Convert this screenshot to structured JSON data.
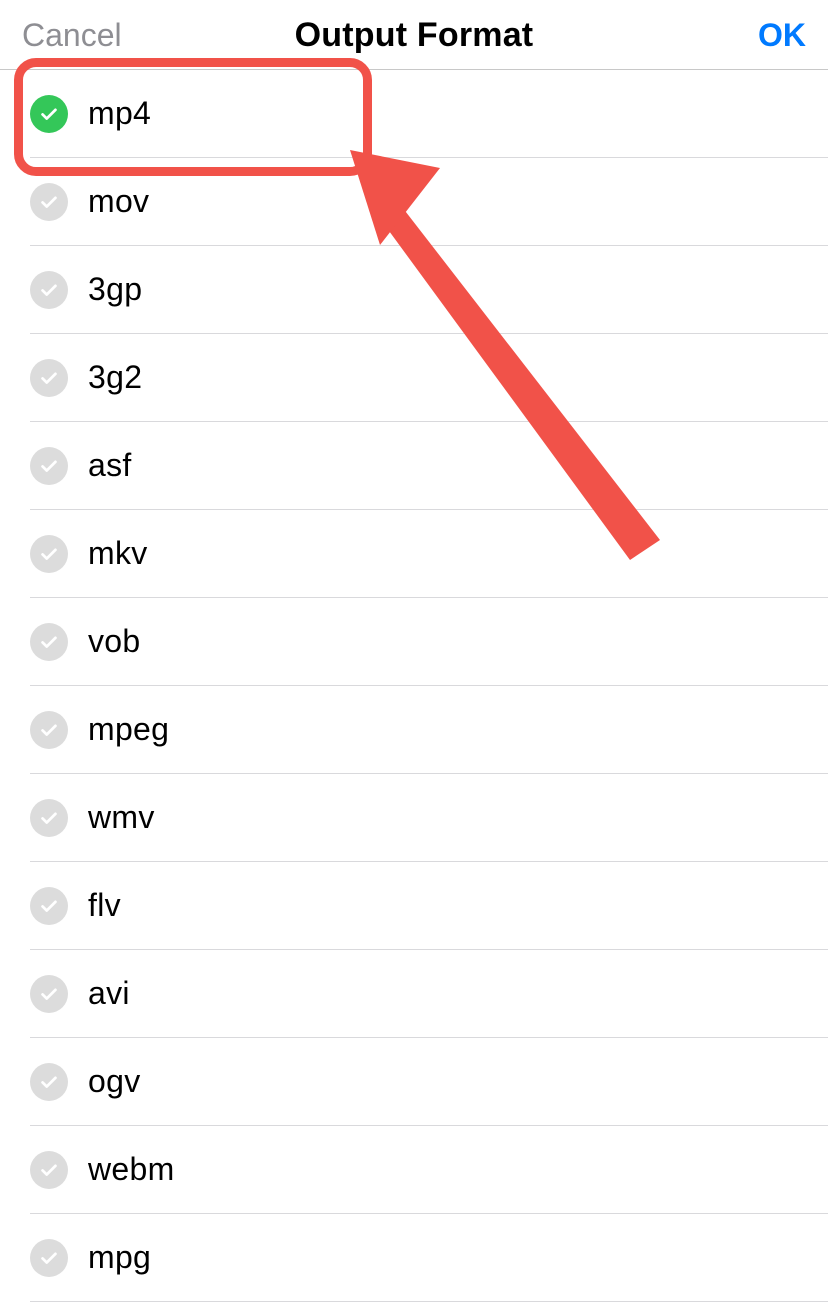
{
  "navbar": {
    "cancel": "Cancel",
    "title": "Output Format",
    "ok": "OK"
  },
  "colors": {
    "accent_blue": "#007aff",
    "accent_green": "#34c759",
    "annotation_red": "#f15249",
    "gray_text": "#8e8e93",
    "separator": "#d9d9dc",
    "check_unselected_bg": "#dcdcdc"
  },
  "formats": [
    {
      "value": "mp4",
      "selected": true
    },
    {
      "value": "mov",
      "selected": false
    },
    {
      "value": "3gp",
      "selected": false
    },
    {
      "value": "3g2",
      "selected": false
    },
    {
      "value": "asf",
      "selected": false
    },
    {
      "value": "mkv",
      "selected": false
    },
    {
      "value": "vob",
      "selected": false
    },
    {
      "value": "mpeg",
      "selected": false
    },
    {
      "value": "wmv",
      "selected": false
    },
    {
      "value": "flv",
      "selected": false
    },
    {
      "value": "avi",
      "selected": false
    },
    {
      "value": "ogv",
      "selected": false
    },
    {
      "value": "webm",
      "selected": false
    },
    {
      "value": "mpg",
      "selected": false
    }
  ],
  "annotation": {
    "highlighted_option": "mp4"
  }
}
